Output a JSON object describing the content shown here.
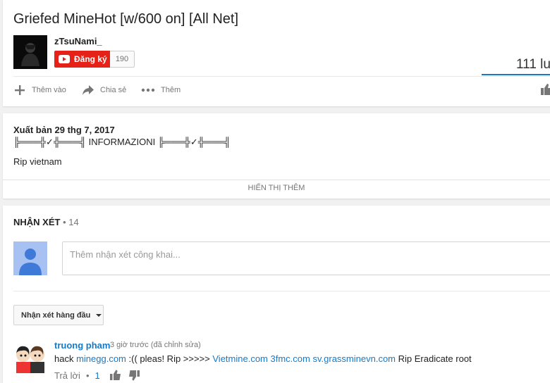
{
  "video": {
    "title": "Griefed MineHot [w/600 on] [All Net]",
    "channel_name": "zTsuNami_",
    "subscribe_label": "Đăng ký",
    "subscriber_count": "190",
    "view_count": "111 lu",
    "actions": {
      "add_label": "Thêm vào",
      "share_label": "Chia sẻ",
      "more_label": "Thêm"
    }
  },
  "description": {
    "published": "Xuất bản 29 thg 7, 2017",
    "line1": "╠═══╬✓╬═══╣ INFORMAZIONI ╠═══╬✓╬═══╣",
    "line2": "Rip vietnam",
    "show_more": "HIỂN THỊ THÊM"
  },
  "comments": {
    "header_label": "NHẬN XÉT",
    "header_count": "• 14",
    "input_placeholder": "Thêm nhận xét công khai...",
    "sort_label": "Nhận xét hàng đầu",
    "items": [
      {
        "author": "truong pham",
        "time": "3 giờ trước (đã chỉnh sửa)",
        "text_1": "hack ",
        "link_1": "minegg.com",
        "text_2": " :(( pleas!  Rip >>>>>  ",
        "link_2": "Vietmine.com",
        "text_3": " ",
        "link_3": "3fmc.com",
        "text_4": "  ",
        "link_4": "sv.grassminevn.com",
        "text_5": " Rip Eradicate root",
        "reply_label": "Trả lời",
        "dot": "•",
        "likes": "1"
      }
    ]
  },
  "colors": {
    "accent_blue": "#167ac6",
    "subscribe_red": "#e62117"
  },
  "icons": [
    "plus-icon",
    "share-icon",
    "more-dots-icon",
    "thumbs-up-icon",
    "thumbs-down-icon",
    "youtube-play-icon",
    "caret-down-icon"
  ]
}
